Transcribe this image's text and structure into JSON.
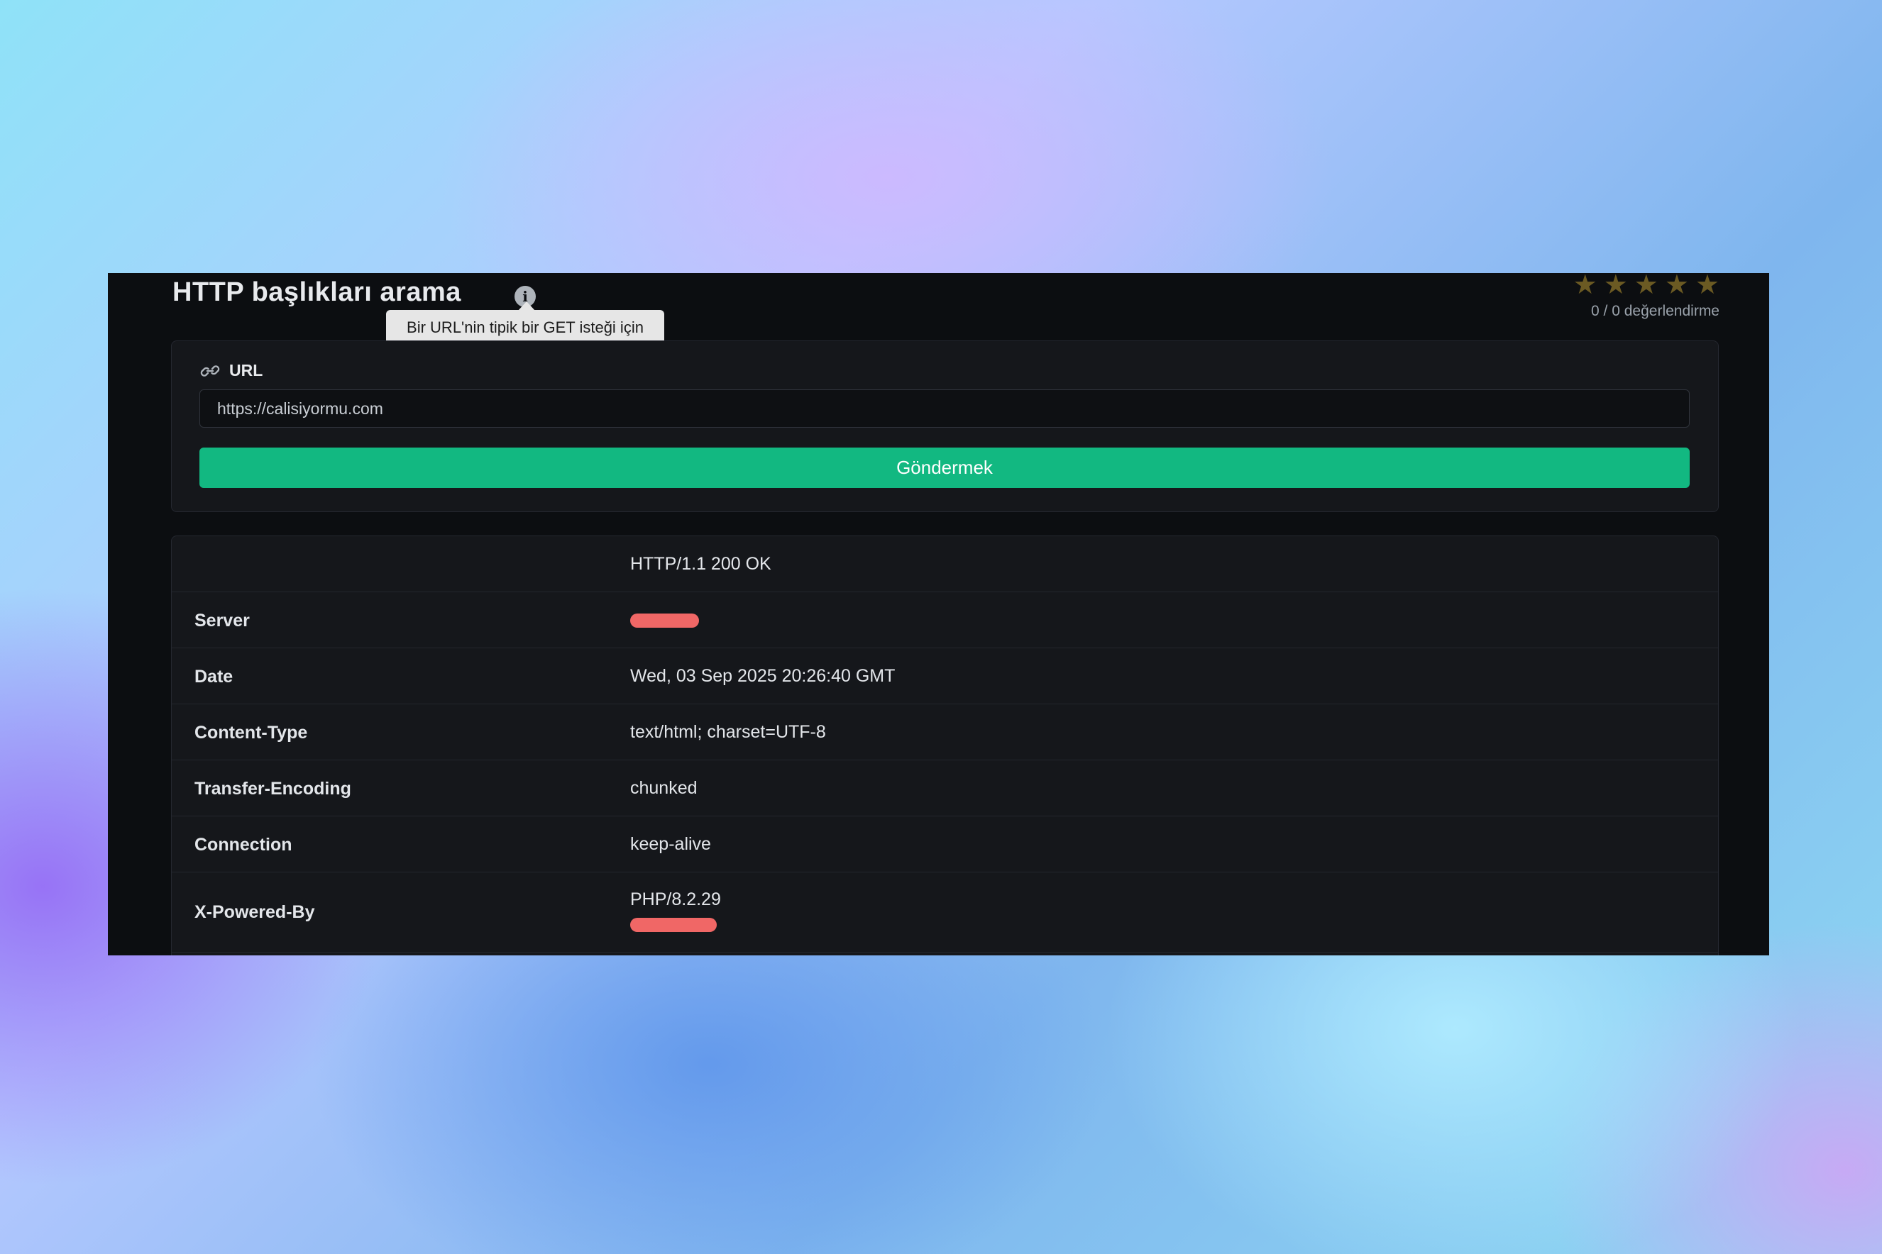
{
  "page": {
    "title": "HTTP başlıkları arama",
    "info_icon": "info-icon",
    "tooltip": "Bir URL'nin tipik bir GET isteği için döndürdüğü tüm HTTP başlıklarını al."
  },
  "rating": {
    "stars_total": 5,
    "stars_filled": 0,
    "star_color": "#6b5a23",
    "count_text": "0 / 0 değerlendirme"
  },
  "form": {
    "url_label": "URL",
    "url_icon": "link-icon",
    "url_value": "https://calisiyormu.com",
    "submit_label": "Göndermek",
    "submit_color": "#12b881"
  },
  "results": {
    "status_line": "HTTP/1.1 200 OK",
    "headers": [
      {
        "name": "Server",
        "value": "",
        "redacted": true
      },
      {
        "name": "Date",
        "value": "Wed, 03 Sep 2025 20:26:40 GMT"
      },
      {
        "name": "Content-Type",
        "value": "text/html; charset=UTF-8"
      },
      {
        "name": "Transfer-Encoding",
        "value": "chunked"
      },
      {
        "name": "Connection",
        "value": "keep-alive"
      },
      {
        "name": "X-Powered-By",
        "value": "PHP/8.2.29",
        "redacted": true
      }
    ],
    "redaction_color": "#f06766"
  }
}
